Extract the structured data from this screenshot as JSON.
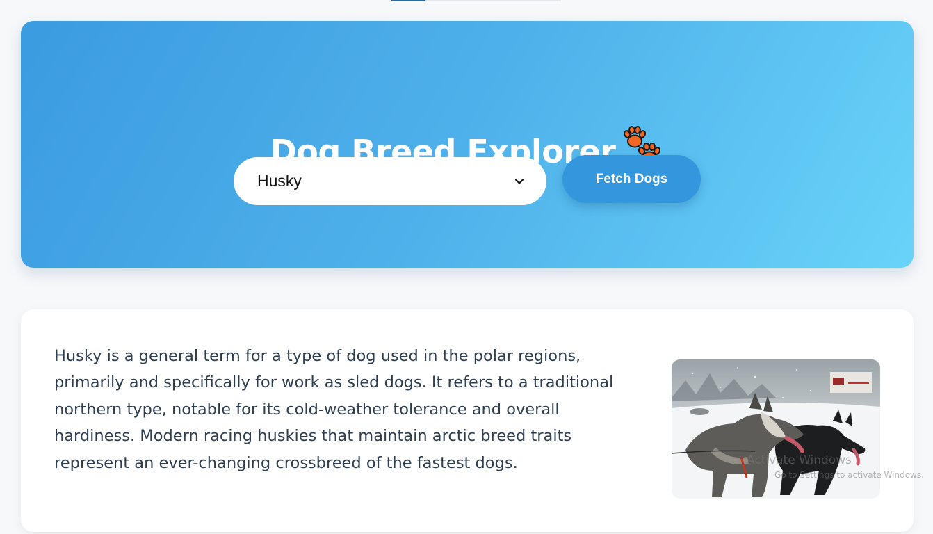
{
  "header": {
    "title": "Dog Breed Explorer",
    "title_icon": "paw-prints-icon",
    "icon_color": "#f26722"
  },
  "controls": {
    "selected_breed": "Husky",
    "fetch_label": "Fetch Dogs"
  },
  "breed": {
    "description": "Husky is a general term for a type of dog used in the polar regions, primarily and specifically for work as sled dogs. It refers to a traditional northern type, notable for its cold-weather tolerance and overall hardiness. Modern racing huskies that maintain arctic breed traits represent an ever-changing crossbreed of the fastest dogs.",
    "photo_subject": "two huskies pulling a sled in snow"
  },
  "os_overlay": {
    "line1": "Activate Windows",
    "line2": "Go to Settings to activate Windows."
  },
  "colors": {
    "hero_gradient_start": "#3b9be0",
    "hero_gradient_end": "#69d3f9",
    "button": "#3497dd",
    "text": "#2c3e50"
  }
}
